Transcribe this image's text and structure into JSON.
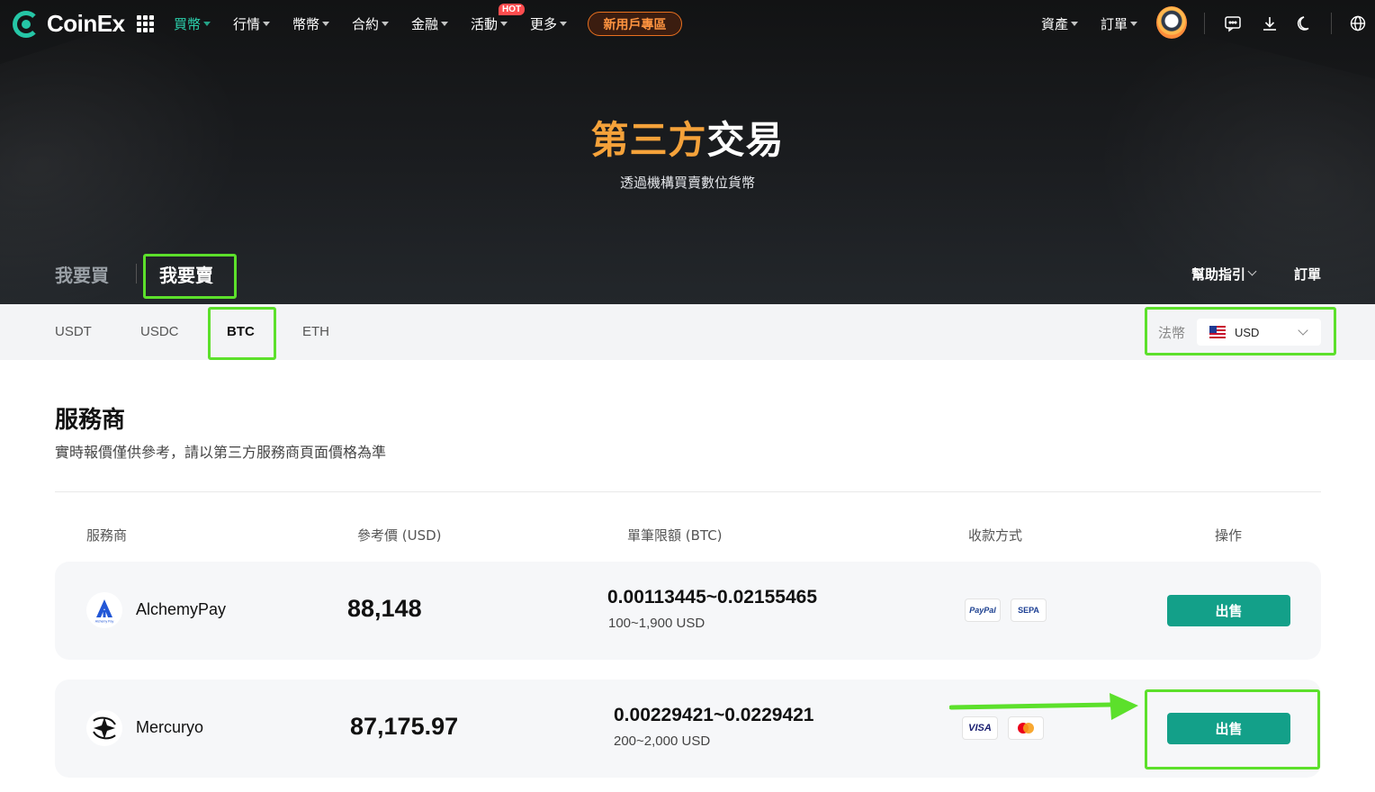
{
  "brand": {
    "name": "CoinEx"
  },
  "nav": {
    "items": [
      {
        "label": "買幣",
        "active": true
      },
      {
        "label": "行情"
      },
      {
        "label": "幣幣"
      },
      {
        "label": "合約"
      },
      {
        "label": "金融"
      },
      {
        "label": "活動"
      },
      {
        "label": "更多"
      }
    ],
    "hot_badge": "HOT",
    "promo_label": "新用戶專區",
    "right_items": [
      {
        "label": "資產"
      },
      {
        "label": "訂單"
      }
    ],
    "icons": [
      "grid-icon",
      "chat-icon",
      "download-icon",
      "moon-icon",
      "globe-icon"
    ]
  },
  "hero": {
    "title_highlight": "第三方",
    "title_rest": "交易",
    "subtitle": "透過機構買賣數位貨幣"
  },
  "mode_tabs": {
    "buy": "我要買",
    "sell": "我要賣",
    "active": "sell"
  },
  "help_link": "幫助指引",
  "orders_link": "訂單",
  "coin_tabs": [
    {
      "label": "USDT"
    },
    {
      "label": "USDC"
    },
    {
      "label": "BTC",
      "active": true
    },
    {
      "label": "ETH"
    }
  ],
  "fiat": {
    "label": "法幣",
    "value": "USD"
  },
  "providers_section": {
    "title": "服務商",
    "note": "實時報價僅供參考，請以第三方服務商頁面價格為準",
    "columns": {
      "provider": "服務商",
      "price": "參考價 (USD)",
      "limit": "單筆限額 (BTC)",
      "payment": "收款方式",
      "action": "操作"
    },
    "rows": [
      {
        "name": "AlchemyPay",
        "logo_text": "Alchemy Pay",
        "price": "88,148",
        "btc_range": "0.00113445~0.02155465",
        "fiat_range": "100~1,900 USD",
        "payments": [
          "PayPal",
          "SEPA"
        ],
        "action": "出售"
      },
      {
        "name": "Mercuryo",
        "price": "87,175.97",
        "btc_range": "0.00229421~0.0229421",
        "fiat_range": "200~2,000 USD",
        "payments": [
          "VISA",
          "Mastercard"
        ],
        "action": "出售"
      }
    ]
  },
  "colors": {
    "accent": "#13a089",
    "nav_active": "#2bd2ae",
    "highlight_box": "#5ce02b",
    "title_orange": "#f5a23a",
    "promo_orange": "#e9701f"
  }
}
